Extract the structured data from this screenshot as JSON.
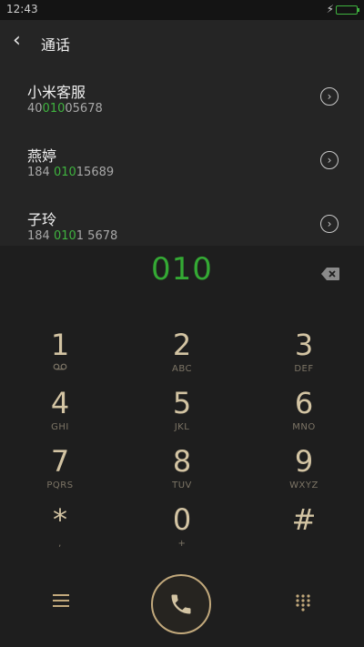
{
  "status": {
    "time": "12:43",
    "charging_icon": "lightning-icon",
    "battery_icon": "battery-icon"
  },
  "header": {
    "title": "通话",
    "back_icon": "chevron-left-icon"
  },
  "contacts": [
    {
      "name": "小米客服",
      "number_prefix": "40",
      "number_match": "010",
      "number_suffix": "05678",
      "arrow_icon": "circle-chevron-right-icon"
    },
    {
      "name": "燕婷",
      "number_prefix": "184 ",
      "number_match": "010",
      "number_suffix": "15689",
      "arrow_icon": "circle-chevron-right-icon"
    },
    {
      "name": "子玲",
      "number_prefix": "184 ",
      "number_match": "010",
      "number_suffix": "1 5678",
      "arrow_icon": "circle-chevron-right-icon"
    }
  ],
  "dialer": {
    "input": "010",
    "delete_icon": "backspace-icon"
  },
  "keypad": [
    {
      "digit": "1",
      "letters": ""
    },
    {
      "digit": "2",
      "letters": "ABC"
    },
    {
      "digit": "3",
      "letters": "DEF"
    },
    {
      "digit": "4",
      "letters": "GHI"
    },
    {
      "digit": "5",
      "letters": "JKL"
    },
    {
      "digit": "6",
      "letters": "MNO"
    },
    {
      "digit": "7",
      "letters": "PQRS"
    },
    {
      "digit": "8",
      "letters": "TUV"
    },
    {
      "digit": "9",
      "letters": "WXYZ"
    },
    {
      "digit": "*",
      "letters": ","
    },
    {
      "digit": "0",
      "letters": "+"
    },
    {
      "digit": "#",
      "letters": ""
    }
  ],
  "bottom": {
    "menu_icon": "menu-icon",
    "call_icon": "phone-icon",
    "keypad_icon": "dialpad-icon"
  },
  "colors": {
    "accent_green": "#34a934",
    "key_gold": "#d3c4a3",
    "background": "#1e1e1e"
  }
}
